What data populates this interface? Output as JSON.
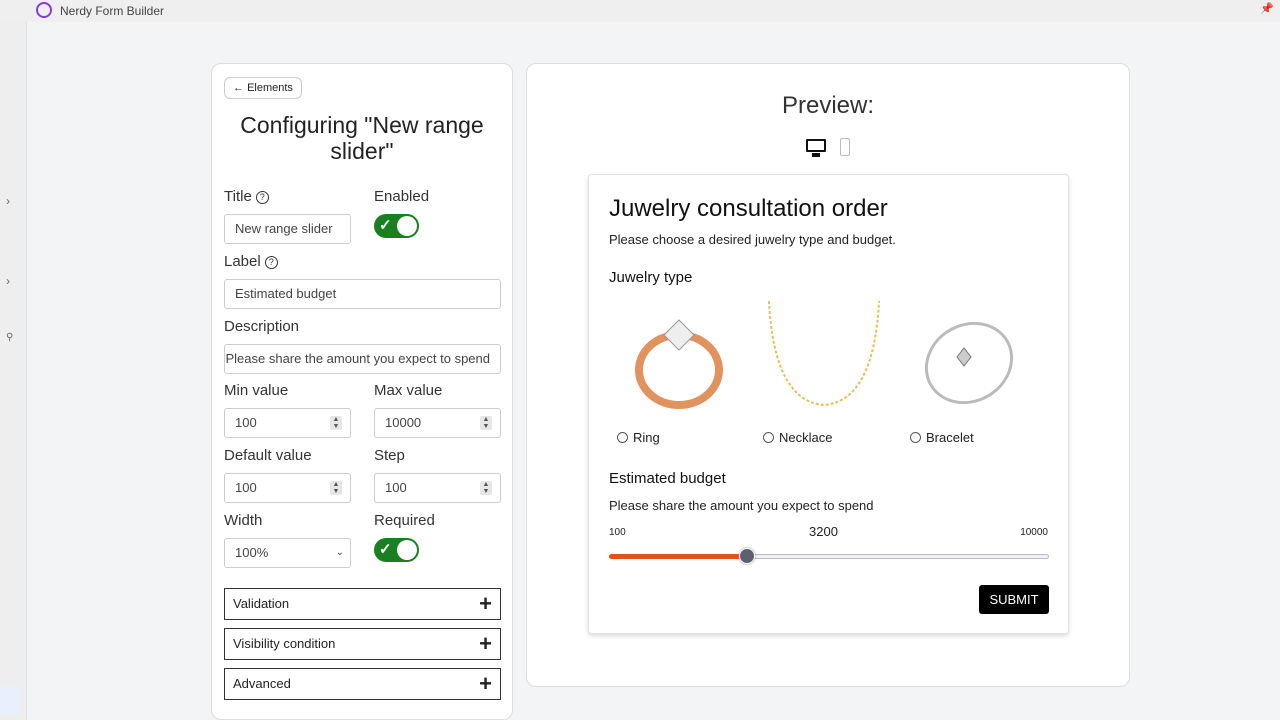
{
  "app": {
    "title": "Nerdy Form Builder"
  },
  "config": {
    "back_label": "Elements",
    "heading": "Configuring \"New range slider\"",
    "title_label": "Title",
    "title_value": "New range slider",
    "enabled_label": "Enabled",
    "enabled": true,
    "label_label": "Label",
    "label_value": "Estimated budget",
    "description_label": "Description",
    "description_value": "Please share the amount you expect to spend",
    "min_label": "Min value",
    "min_value": "100",
    "max_label": "Max value",
    "max_value": "10000",
    "default_label": "Default value",
    "default_value": "100",
    "step_label": "Step",
    "step_value": "100",
    "width_label": "Width",
    "width_value": "100%",
    "required_label": "Required",
    "required": true,
    "sections": [
      "Validation",
      "Visibility condition",
      "Advanced"
    ]
  },
  "preview": {
    "title": "Preview:",
    "form": {
      "title": "Juwelry consultation order",
      "subtitle": "Please choose a desired juwelry type and budget.",
      "type_label": "Juwelry type",
      "options": [
        "Ring",
        "Necklace",
        "Bracelet"
      ],
      "budget_label": "Estimated budget",
      "budget_description": "Please share the amount you expect to spend",
      "slider": {
        "min": "100",
        "max": "10000",
        "value": "3200",
        "fraction": 0.313,
        "fill_color": "#e0531f"
      },
      "submit_label": "SUBMIT"
    }
  }
}
